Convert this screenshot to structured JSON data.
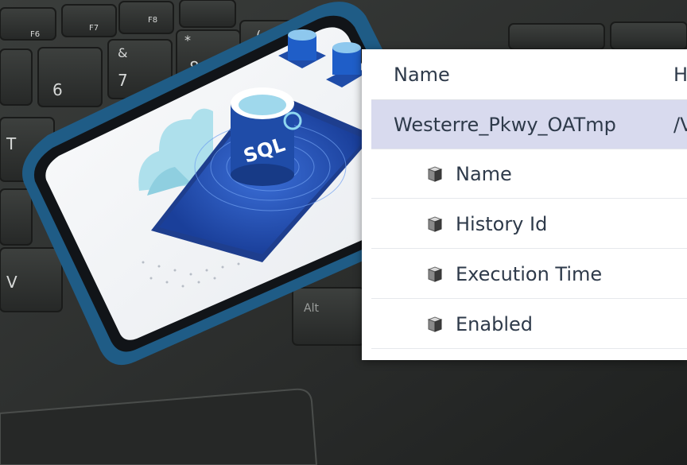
{
  "table": {
    "columns": {
      "name": "Name",
      "history_truncated": "H"
    },
    "selected_row": {
      "name": "Westerre_Pkwy_OATmp",
      "path_truncated": "/V"
    },
    "child_rows": [
      {
        "label": "Name",
        "icon": "cube-icon"
      },
      {
        "label": "History Id",
        "icon": "cube-icon"
      },
      {
        "label": "Execution Time",
        "icon": "cube-icon"
      },
      {
        "label": "Enabled",
        "icon": "cube-icon"
      }
    ]
  },
  "phone": {
    "badge_text": "SQL"
  },
  "keyboard": {
    "keys": [
      "F6",
      "F7",
      "F8",
      "6",
      "7",
      "8",
      "T",
      "V",
      "Alt",
      "&",
      "*",
      "("
    ]
  }
}
